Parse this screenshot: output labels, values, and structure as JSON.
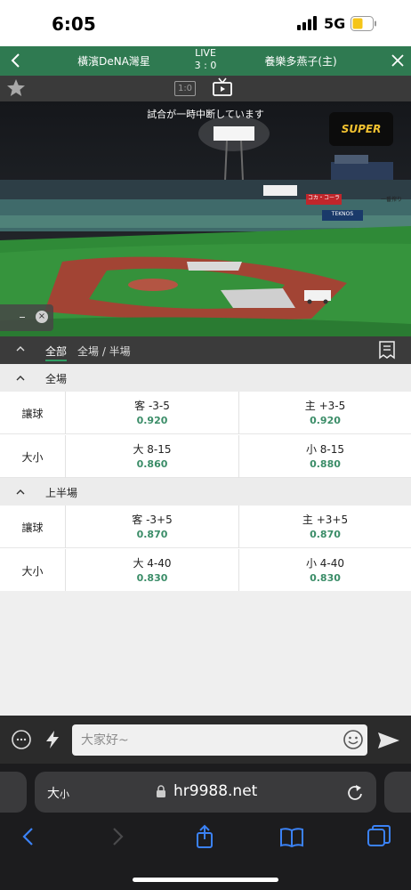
{
  "status_bar": {
    "time": "6:05",
    "network": "5G",
    "battery_color": "#f5c518"
  },
  "match_header": {
    "away_team": "橫濱DeNA灣星",
    "home_team": "養樂多燕子(主)",
    "live_label": "LIVE",
    "score": "3 : 0",
    "bg_color": "#2f7a51"
  },
  "toolbar": {
    "score_button_label": "1:0",
    "star_icon": "star-icon",
    "tv_icon": "tv-icon"
  },
  "video": {
    "caption": "試合が一時中断しています",
    "overlay_logo": "SUPER",
    "signs": [
      "コカ・コーラ",
      "TEKNOS",
      "一番搾り"
    ]
  },
  "tabs": {
    "items": [
      "全部",
      "全場 / 半場"
    ],
    "active": "全部"
  },
  "sections": [
    {
      "title": "全場",
      "rows": [
        {
          "label": "讓球",
          "left": {
            "line": "客 -3-5",
            "odds": "0.920"
          },
          "right": {
            "line": "主 +3-5",
            "odds": "0.920"
          }
        },
        {
          "label": "大小",
          "left": {
            "line": "大 8-15",
            "odds": "0.860"
          },
          "right": {
            "line": "小 8-15",
            "odds": "0.880"
          }
        }
      ]
    },
    {
      "title": "上半場",
      "rows": [
        {
          "label": "讓球",
          "left": {
            "line": "客 -3+5",
            "odds": "0.870"
          },
          "right": {
            "line": "主 +3+5",
            "odds": "0.870"
          }
        },
        {
          "label": "大小",
          "left": {
            "line": "大 4-40",
            "odds": "0.830"
          },
          "right": {
            "line": "小 4-40",
            "odds": "0.830"
          }
        }
      ]
    }
  ],
  "chat": {
    "placeholder": "大家好~"
  },
  "browser": {
    "text_size_label": "大",
    "text_size_small": "小",
    "url": "hr9988.net"
  },
  "colors": {
    "odds_green": "#3b8d68",
    "accent_green": "#2f9e63"
  }
}
